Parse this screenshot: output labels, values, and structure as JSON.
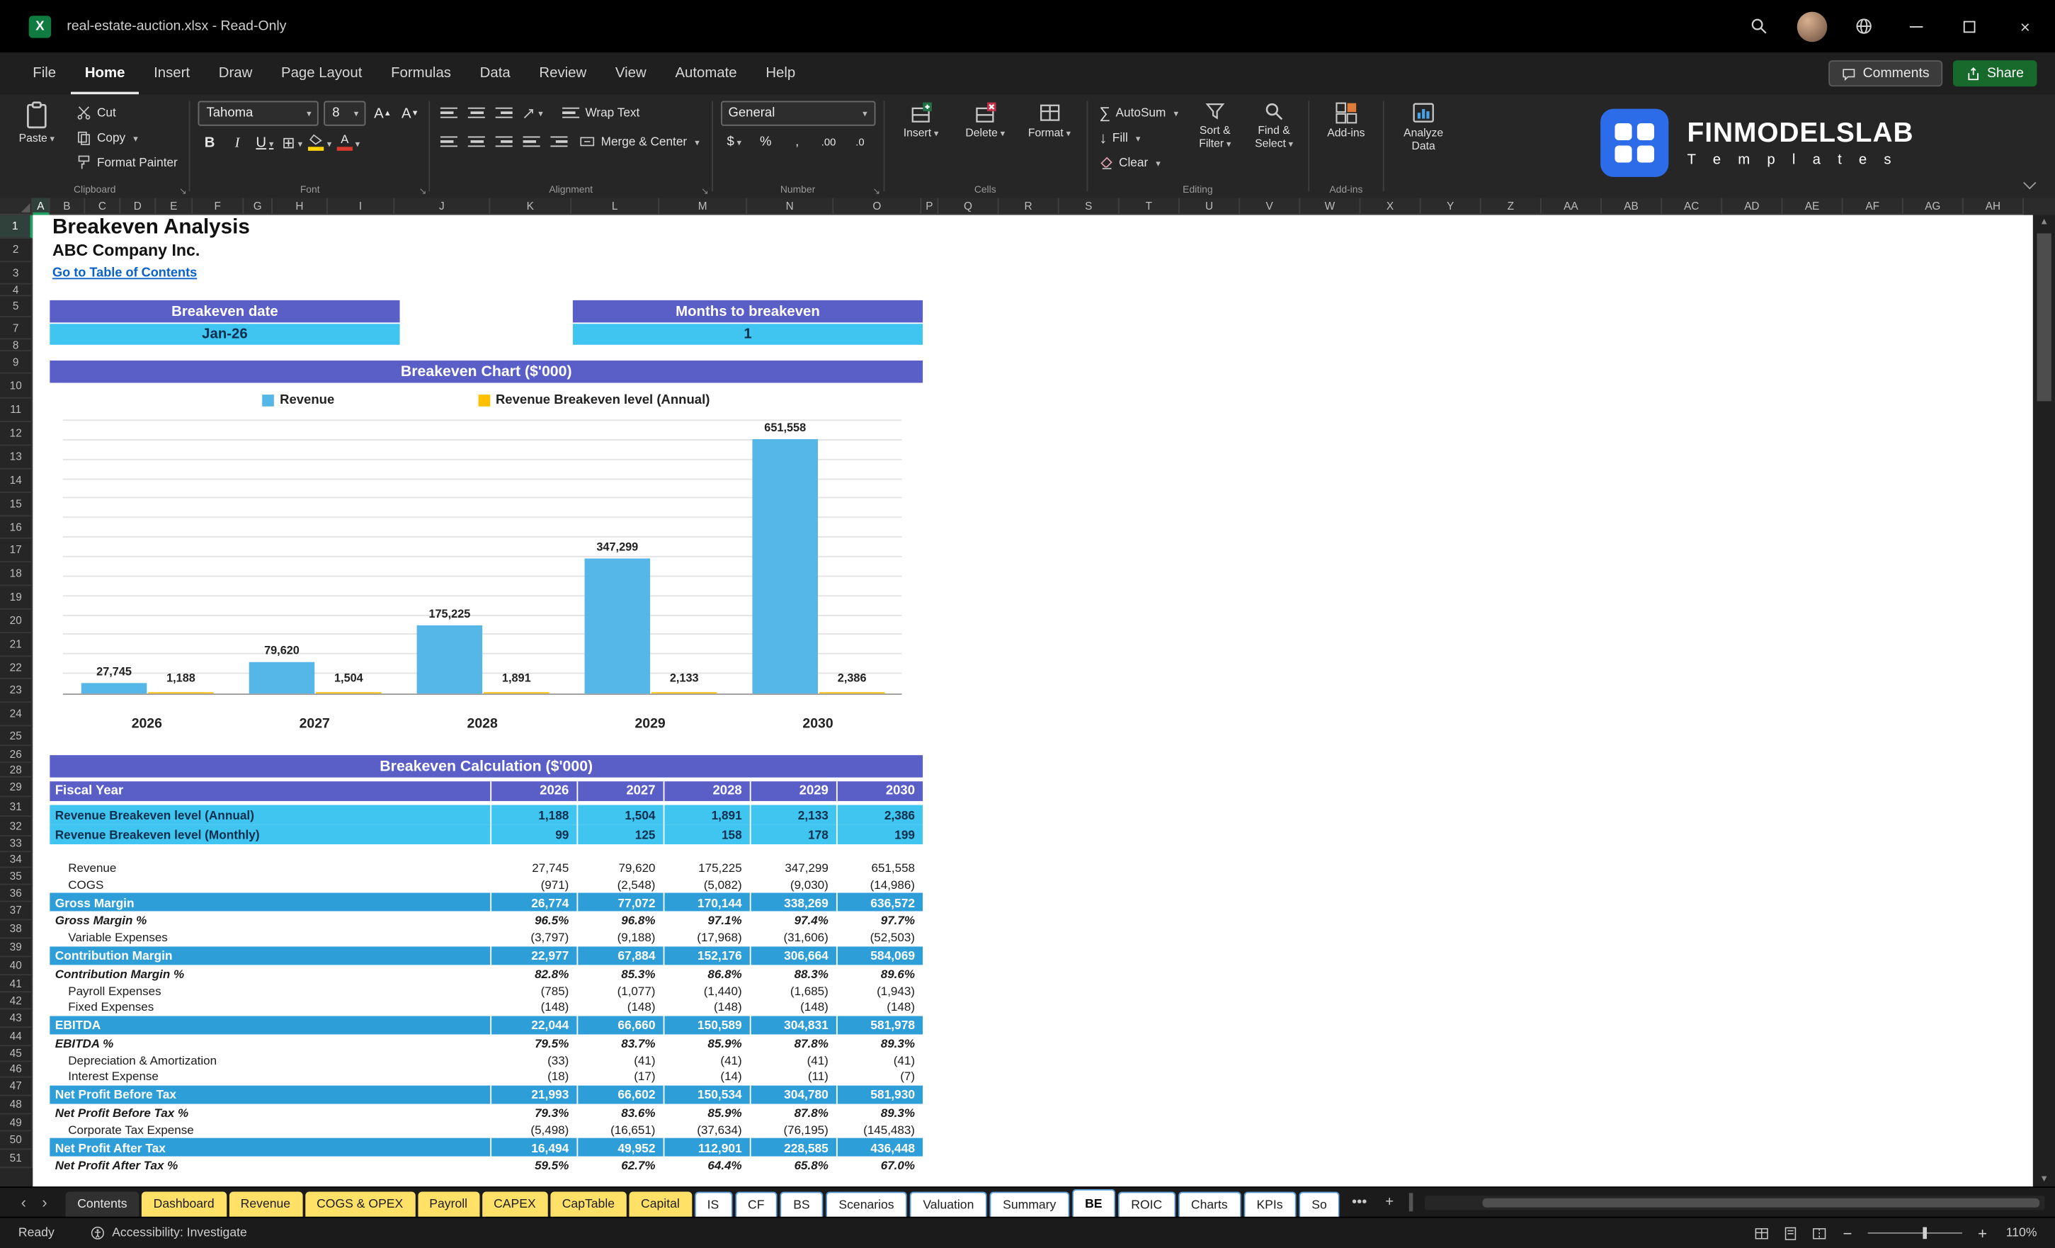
{
  "window": {
    "title": "real-estate-auction.xlsx  -  Read-Only",
    "comments_label": "Comments",
    "share_label": "Share"
  },
  "menu": {
    "items": [
      "File",
      "Home",
      "Insert",
      "Draw",
      "Page Layout",
      "Formulas",
      "Data",
      "Review",
      "View",
      "Automate",
      "Help"
    ],
    "active": "Home"
  },
  "ribbon": {
    "clipboard": {
      "label": "Clipboard",
      "paste": "Paste",
      "cut": "Cut",
      "copy": "Copy",
      "format_painter": "Format Painter"
    },
    "font": {
      "label": "Font",
      "family": "Tahoma",
      "size": "8",
      "bold": "B",
      "italic": "I",
      "underline": "U"
    },
    "alignment": {
      "label": "Alignment",
      "wrap_text": "Wrap Text",
      "merge_center": "Merge & Center"
    },
    "number": {
      "label": "Number",
      "format": "General",
      "currency": "$",
      "percent": "%",
      "comma": ",",
      "inc_dec": ".00",
      "dec_dec": ".0"
    },
    "cells": {
      "label": "Cells",
      "insert": "Insert",
      "delete": "Delete",
      "format": "Format"
    },
    "editing": {
      "label": "Editing",
      "autosum": "AutoSum",
      "fill": "Fill",
      "clear": "Clear",
      "sort_filter": "Sort & Filter",
      "find_select": "Find & Select"
    },
    "addins": {
      "label": "Add-ins",
      "button": "Add-ins",
      "analyze": "Analyze Data"
    }
  },
  "logo": {
    "title": "FINMODELSLAB",
    "subtitle": "T e m p l a t e s"
  },
  "grid": {
    "columns": [
      "A",
      "B",
      "C",
      "D",
      "E",
      "F",
      "G",
      "H",
      "I",
      "J",
      "K",
      "L",
      "M",
      "N",
      "O",
      "P",
      "Q",
      "R",
      "S",
      "T",
      "U",
      "V",
      "W",
      "X",
      "Y",
      "Z",
      "AA",
      "AB",
      "AC",
      "AD",
      "AE",
      "AF",
      "AG",
      "AH"
    ],
    "rows": [
      "1",
      "2",
      "3",
      "4",
      "5",
      "7",
      "8",
      "9",
      "10",
      "11",
      "12",
      "13",
      "14",
      "15",
      "16",
      "17",
      "18",
      "19",
      "20",
      "21",
      "22",
      "23",
      "24",
      "25",
      "26",
      "28",
      "29",
      "31",
      "32",
      "33",
      "34",
      "35",
      "36",
      "37",
      "38",
      "39",
      "40",
      "41",
      "42",
      "43",
      "44",
      "45",
      "46",
      "47",
      "48",
      "49",
      "50",
      "51"
    ]
  },
  "sheet": {
    "title": "Breakeven Analysis",
    "company": "ABC Company Inc.",
    "toc_link": "Go to Table of Contents",
    "breakeven_date_label": "Breakeven date",
    "breakeven_date_value": "Jan-26",
    "months_label": "Months to breakeven",
    "months_value": "1",
    "calc_title": "Breakeven Calculation ($'000)"
  },
  "chart_data": {
    "type": "bar",
    "title": "Breakeven Chart ($'000)",
    "categories": [
      "2026",
      "2027",
      "2028",
      "2029",
      "2030"
    ],
    "series": [
      {
        "name": "Revenue",
        "color": "#54b7e8",
        "values": [
          27745,
          79620,
          175225,
          347299,
          651558
        ],
        "labels": [
          "27,745",
          "79,620",
          "175,225",
          "347,299",
          "651,558"
        ]
      },
      {
        "name": "Revenue Breakeven level (Annual)",
        "color": "#ffc000",
        "values": [
          1188,
          1504,
          1891,
          2133,
          2386
        ],
        "labels": [
          "1,188",
          "1,504",
          "1,891",
          "2,133",
          "2,386"
        ]
      }
    ],
    "ylim": [
      0,
      700000
    ],
    "grid_step": 50000,
    "gridlines": true,
    "legend_position": "top"
  },
  "table": {
    "header_label": "Fiscal Year",
    "years": [
      "2026",
      "2027",
      "2028",
      "2029",
      "2030"
    ],
    "rows": [
      {
        "label": "Revenue Breakeven level (Annual)",
        "style": "sub",
        "values": [
          "1,188",
          "1,504",
          "1,891",
          "2,133",
          "2,386"
        ]
      },
      {
        "label": "Revenue Breakeven level (Monthly)",
        "style": "sub",
        "values": [
          "99",
          "125",
          "158",
          "178",
          "199"
        ]
      },
      {
        "label": "Revenue",
        "style": "item",
        "values": [
          "27,745",
          "79,620",
          "175,225",
          "347,299",
          "651,558"
        ]
      },
      {
        "label": "COGS",
        "style": "item",
        "values": [
          "(971)",
          "(2,548)",
          "(5,082)",
          "(9,030)",
          "(14,986)"
        ]
      },
      {
        "label": "Gross Margin",
        "style": "total",
        "values": [
          "26,774",
          "77,072",
          "170,144",
          "338,269",
          "636,572"
        ]
      },
      {
        "label": "Gross Margin %",
        "style": "pct",
        "values": [
          "96.5%",
          "96.8%",
          "97.1%",
          "97.4%",
          "97.7%"
        ]
      },
      {
        "label": "Variable Expenses",
        "style": "item",
        "values": [
          "(3,797)",
          "(9,188)",
          "(17,968)",
          "(31,606)",
          "(52,503)"
        ]
      },
      {
        "label": "Contribution Margin",
        "style": "total",
        "values": [
          "22,977",
          "67,884",
          "152,176",
          "306,664",
          "584,069"
        ]
      },
      {
        "label": "Contribution Margin %",
        "style": "pct",
        "values": [
          "82.8%",
          "85.3%",
          "86.8%",
          "88.3%",
          "89.6%"
        ]
      },
      {
        "label": "Payroll Expenses",
        "style": "item",
        "values": [
          "(785)",
          "(1,077)",
          "(1,440)",
          "(1,685)",
          "(1,943)"
        ]
      },
      {
        "label": "Fixed Expenses",
        "style": "item",
        "values": [
          "(148)",
          "(148)",
          "(148)",
          "(148)",
          "(148)"
        ]
      },
      {
        "label": "EBITDA",
        "style": "total",
        "values": [
          "22,044",
          "66,660",
          "150,589",
          "304,831",
          "581,978"
        ]
      },
      {
        "label": "EBITDA %",
        "style": "pct",
        "values": [
          "79.5%",
          "83.7%",
          "85.9%",
          "87.8%",
          "89.3%"
        ]
      },
      {
        "label": "Depreciation & Amortization",
        "style": "item",
        "values": [
          "(33)",
          "(41)",
          "(41)",
          "(41)",
          "(41)"
        ]
      },
      {
        "label": "Interest Expense",
        "style": "item",
        "values": [
          "(18)",
          "(17)",
          "(14)",
          "(11)",
          "(7)"
        ]
      },
      {
        "label": "Net Profit Before Tax",
        "style": "total",
        "values": [
          "21,993",
          "66,602",
          "150,534",
          "304,780",
          "581,930"
        ]
      },
      {
        "label": "Net Profit Before Tax %",
        "style": "pct",
        "values": [
          "79.3%",
          "83.6%",
          "85.9%",
          "87.8%",
          "89.3%"
        ]
      },
      {
        "label": "Corporate Tax Expense",
        "style": "item",
        "values": [
          "(5,498)",
          "(16,651)",
          "(37,634)",
          "(76,195)",
          "(145,483)"
        ]
      },
      {
        "label": "Net Profit After Tax",
        "style": "total",
        "values": [
          "16,494",
          "49,952",
          "112,901",
          "228,585",
          "436,448"
        ]
      },
      {
        "label": "Net Profit After Tax %",
        "style": "pct",
        "values": [
          "59.5%",
          "62.7%",
          "64.4%",
          "65.8%",
          "67.0%"
        ]
      }
    ]
  },
  "tabs": {
    "list": [
      {
        "label": "Contents",
        "style": "dark"
      },
      {
        "label": "Dashboard",
        "style": "yellow"
      },
      {
        "label": "Revenue",
        "style": "yellow"
      },
      {
        "label": "COGS & OPEX",
        "style": "yellow"
      },
      {
        "label": "Payroll",
        "style": "yellow"
      },
      {
        "label": "CAPEX",
        "style": "yellow"
      },
      {
        "label": "CapTable",
        "style": "yellow"
      },
      {
        "label": "Capital",
        "style": "yellow"
      },
      {
        "label": "IS",
        "style": "light"
      },
      {
        "label": "CF",
        "style": "light"
      },
      {
        "label": "BS",
        "style": "light"
      },
      {
        "label": "Scenarios",
        "style": "light"
      },
      {
        "label": "Valuation",
        "style": "light"
      },
      {
        "label": "Summary",
        "style": "light"
      },
      {
        "label": "BE",
        "style": "active"
      },
      {
        "label": "ROIC",
        "style": "light"
      },
      {
        "label": "Charts",
        "style": "light"
      },
      {
        "label": "KPIs",
        "style": "light"
      },
      {
        "label": "So",
        "style": "light"
      }
    ],
    "more": "•••",
    "add": "+"
  },
  "status": {
    "ready": "Ready",
    "accessibility": "Accessibility: Investigate",
    "zoom": "110%"
  },
  "colors": {
    "purple_header": "#5a5fc8",
    "light_blue": "#40c4f0",
    "total_blue": "#2e9ed8",
    "bar_blue": "#54b7e8",
    "breakeven_yellow": "#ffc000",
    "tab_yellow": "#ffe168",
    "share_green": "#17692c",
    "link_blue": "#0a62c9"
  }
}
